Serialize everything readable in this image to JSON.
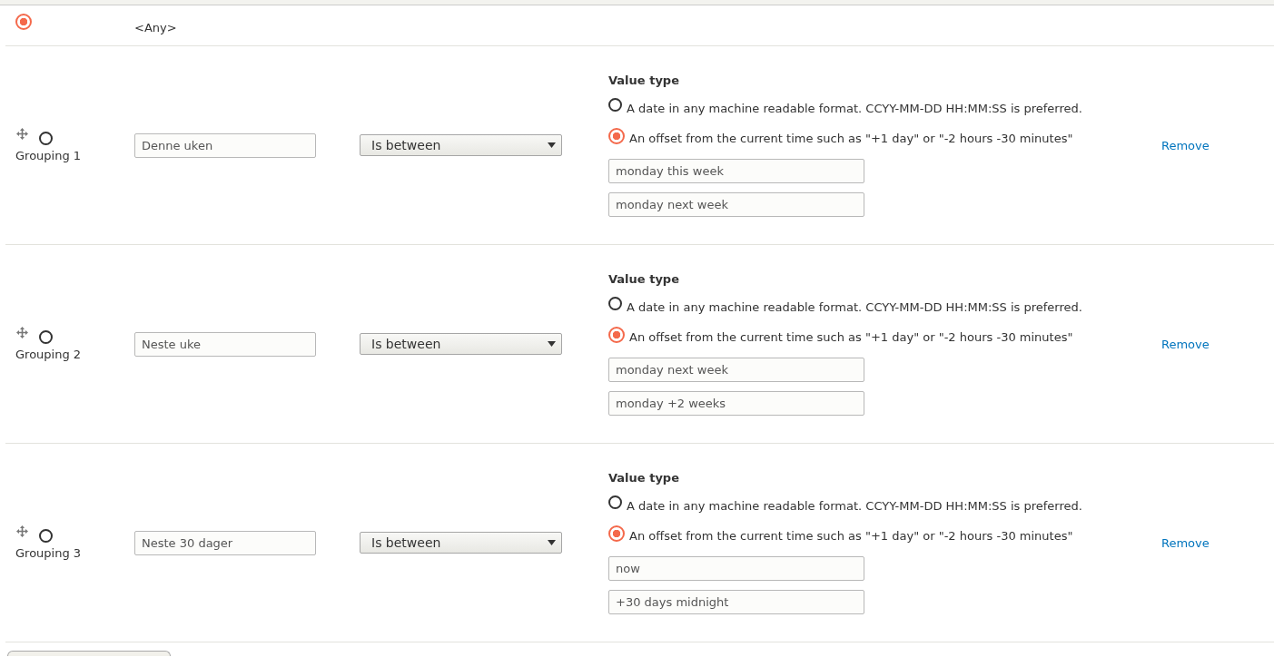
{
  "any_row": {
    "selected": true,
    "label": "<Any>"
  },
  "groupings": [
    {
      "selected": false,
      "label": "Grouping 1",
      "title": "Denne uken",
      "operator": "Is between",
      "value_type_heading": "Value type",
      "options": [
        {
          "label": "A date in any machine readable format. CCYY-MM-DD HH:MM:SS is preferred.",
          "selected": false
        },
        {
          "label": "An offset from the current time such as \"+1 day\" or \"-2 hours -30 minutes\"",
          "selected": true
        }
      ],
      "values": [
        "monday this week",
        "monday next week"
      ],
      "remove": "Remove"
    },
    {
      "selected": false,
      "label": "Grouping 2",
      "title": "Neste uke",
      "operator": "Is between",
      "value_type_heading": "Value type",
      "options": [
        {
          "label": "A date in any machine readable format. CCYY-MM-DD HH:MM:SS is preferred.",
          "selected": false
        },
        {
          "label": "An offset from the current time such as \"+1 day\" or \"-2 hours -30 minutes\"",
          "selected": true
        }
      ],
      "values": [
        "monday next week",
        "monday +2 weeks"
      ],
      "remove": "Remove"
    },
    {
      "selected": false,
      "label": "Grouping 3",
      "title": "Neste 30 dager",
      "operator": "Is between",
      "value_type_heading": "Value type",
      "options": [
        {
          "label": "A date in any machine readable format. CCYY-MM-DD HH:MM:SS is preferred.",
          "selected": false
        },
        {
          "label": "An offset from the current time such as \"+1 day\" or \"-2 hours -30 minutes\"",
          "selected": true
        }
      ],
      "values": [
        "now",
        "+30 days midnight"
      ],
      "remove": "Remove"
    }
  ]
}
